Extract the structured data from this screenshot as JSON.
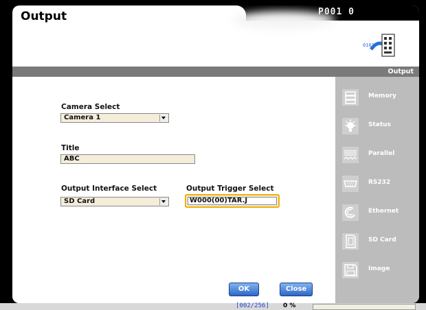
{
  "window": {
    "title": "Output",
    "program_code": "P001 0"
  },
  "header_bar": {
    "label": "Output"
  },
  "form": {
    "camera_select": {
      "label": "Camera Select",
      "value": "Camera 1"
    },
    "title": {
      "label": "Title",
      "value": "ABC"
    },
    "output_interface_select": {
      "label": "Output Interface Select",
      "value": "SD Card"
    },
    "output_trigger_select": {
      "label": "Output Trigger Select",
      "value": "W000(00)TAR.J"
    }
  },
  "buttons": {
    "ok": "OK",
    "close": "Close"
  },
  "sidebar": {
    "items": [
      {
        "label": "Memory",
        "icon": "memory-icon"
      },
      {
        "label": "Status",
        "icon": "status-icon"
      },
      {
        "label": "Parallel",
        "icon": "parallel-icon"
      },
      {
        "label": "RS232",
        "icon": "rs232-icon"
      },
      {
        "label": "Ethernet",
        "icon": "ethernet-icon"
      },
      {
        "label": "SD Card",
        "icon": "sd-card-icon"
      },
      {
        "label": "Image",
        "icon": "image-icon"
      }
    ]
  },
  "status_bar": {
    "count": "[002/256]",
    "percent": "0 %"
  },
  "colors": {
    "accent_button": "#2d66c6",
    "trigger_highlight": "#f0b000",
    "sidebar": "#bcbcbc",
    "field_bg": "#f3edda"
  }
}
